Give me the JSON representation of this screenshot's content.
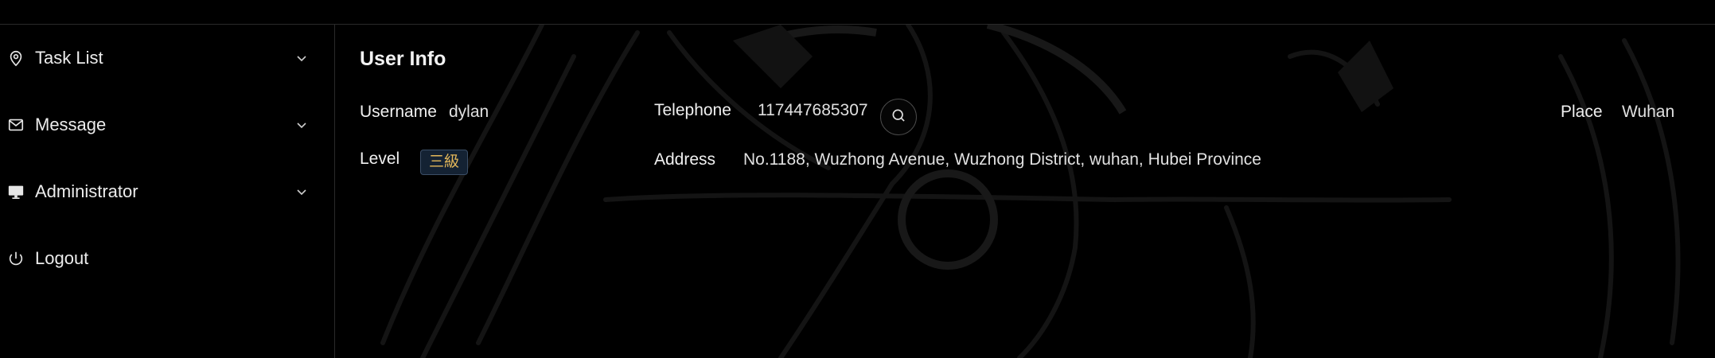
{
  "sidebar": {
    "items": [
      {
        "label": "Task List",
        "icon": "location-pin-icon",
        "expandable": true
      },
      {
        "label": "Message",
        "icon": "mail-icon",
        "expandable": true
      },
      {
        "label": "Administrator",
        "icon": "monitor-icon",
        "expandable": true
      },
      {
        "label": "Logout",
        "icon": "power-icon",
        "expandable": false
      }
    ]
  },
  "user_info": {
    "title": "User Info",
    "username_label": "Username",
    "username": "dylan",
    "telephone_label": "Telephone",
    "telephone": "117447685307",
    "place_label": "Place",
    "place": "Wuhan",
    "level_label": "Level",
    "level": "三級",
    "address_label": "Address",
    "address": "No.1188, Wuzhong Avenue, Wuzhong District, wuhan, Hubei Province"
  },
  "colors": {
    "background": "#000000",
    "divider": "#2a2a2a",
    "badge_text": "#e4b85a",
    "badge_bg": "#142233"
  }
}
